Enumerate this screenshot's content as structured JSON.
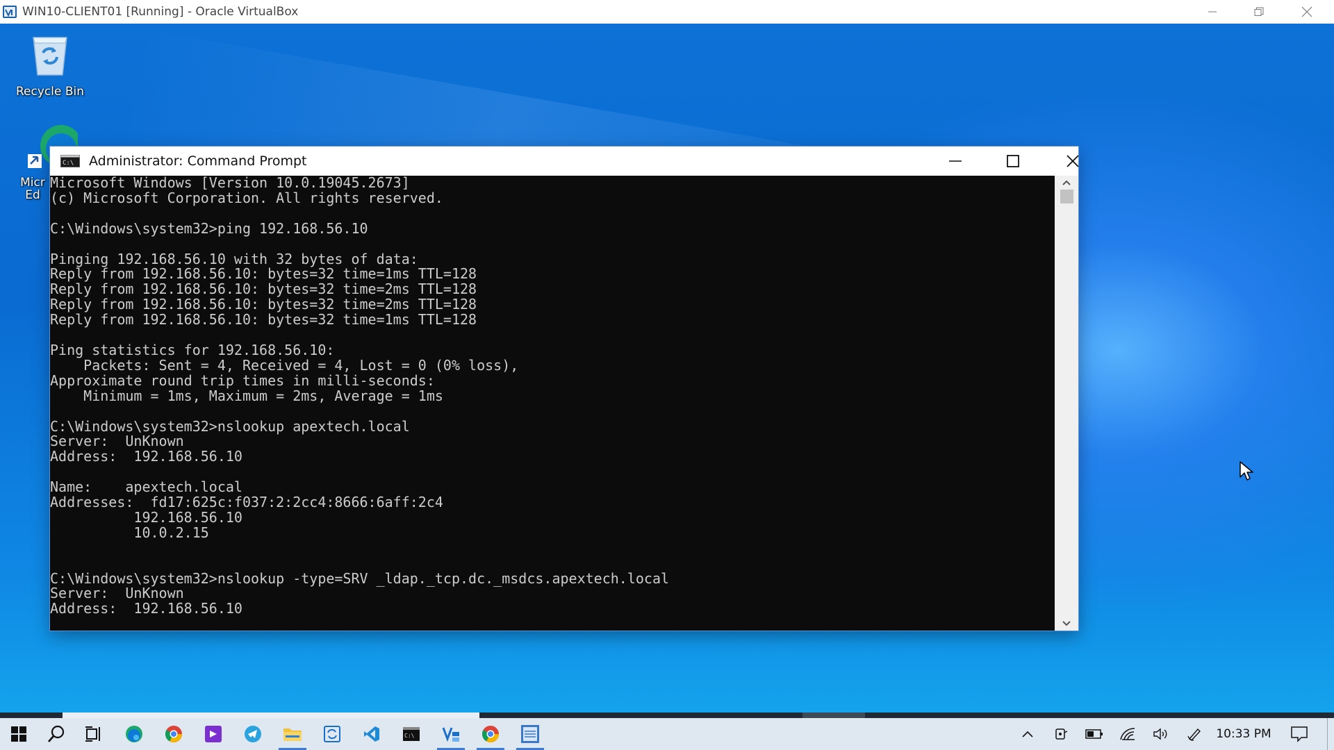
{
  "host_window": {
    "title": "WIN10-CLIENT01 [Running] - Oracle VirtualBox",
    "icon": "virtualbox-icon"
  },
  "desktop": {
    "icons": [
      {
        "label": "Recycle Bin",
        "icon": "recycle-bin-icon"
      },
      {
        "label": "Micr Ed",
        "icon": "microsoft-edge-icon"
      }
    ]
  },
  "cmd_window": {
    "title": "Administrator: Command Prompt",
    "console_lines": [
      "Microsoft Windows [Version 10.0.19045.2673]",
      "(c) Microsoft Corporation. All rights reserved.",
      "",
      "C:\\Windows\\system32>ping 192.168.56.10",
      "",
      "Pinging 192.168.56.10 with 32 bytes of data:",
      "Reply from 192.168.56.10: bytes=32 time=1ms TTL=128",
      "Reply from 192.168.56.10: bytes=32 time=2ms TTL=128",
      "Reply from 192.168.56.10: bytes=32 time=2ms TTL=128",
      "Reply from 192.168.56.10: bytes=32 time=1ms TTL=128",
      "",
      "Ping statistics for 192.168.56.10:",
      "    Packets: Sent = 4, Received = 4, Lost = 0 (0% loss),",
      "Approximate round trip times in milli-seconds:",
      "    Minimum = 1ms, Maximum = 2ms, Average = 1ms",
      "",
      "C:\\Windows\\system32>nslookup apextech.local",
      "Server:  UnKnown",
      "Address:  192.168.56.10",
      "",
      "Name:    apextech.local",
      "Addresses:  fd17:625c:f037:2:2cc4:8666:6aff:2c4",
      "          192.168.56.10",
      "          10.0.2.15",
      "",
      "",
      "C:\\Windows\\system32>nslookup -type=SRV _ldap._tcp.dc._msdcs.apextech.local",
      "Server:  UnKnown",
      "Address:  192.168.56.10"
    ],
    "colors": {
      "console_bg": "#0c0c0c",
      "console_fg": "#cccccc"
    }
  },
  "taskbar": {
    "pinned": [
      {
        "name": "start",
        "icon": "windows-start-icon"
      },
      {
        "name": "search",
        "icon": "search-icon"
      },
      {
        "name": "task-view",
        "icon": "task-view-icon"
      },
      {
        "name": "edge",
        "icon": "microsoft-edge-icon"
      },
      {
        "name": "chrome",
        "icon": "chrome-icon"
      },
      {
        "name": "visual-studio",
        "icon": "visual-studio-icon"
      },
      {
        "name": "telegram",
        "icon": "telegram-icon"
      },
      {
        "name": "file-explorer",
        "icon": "folder-icon"
      },
      {
        "name": "remote-app",
        "icon": "sync-window-icon"
      },
      {
        "name": "vscode",
        "icon": "vscode-icon"
      },
      {
        "name": "terminal",
        "icon": "terminal-icon"
      },
      {
        "name": "app-v",
        "icon": "app-v-icon"
      },
      {
        "name": "chrome-2",
        "icon": "chrome-icon"
      },
      {
        "name": "app-2022",
        "icon": "app-2022-icon"
      }
    ],
    "tray": {
      "icons": [
        "chevron-up-icon",
        "meet-now-icon",
        "battery-icon",
        "wifi-icon",
        "volume-icon",
        "pen-icon"
      ],
      "clock": "10:33 PM",
      "notification_icon": "notification-icon"
    },
    "accent_color": "#3a7bd5"
  }
}
